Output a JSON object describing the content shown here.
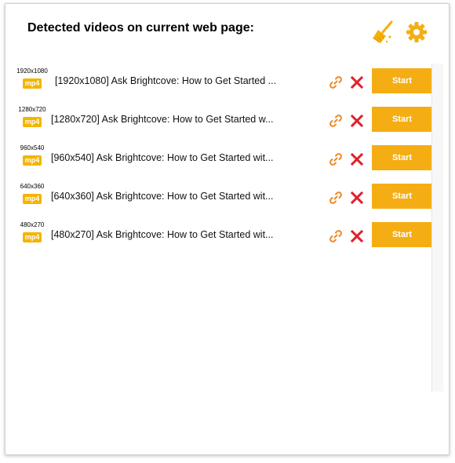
{
  "header": {
    "title": "Detected videos on current web page:"
  },
  "icons": {
    "clean": "broom-icon",
    "settings": "gear-icon"
  },
  "colors": {
    "accent": "#f4ae14",
    "badge": "#f4b400",
    "delete": "#e0202c",
    "link": "#f08a24"
  },
  "videos": [
    {
      "resolution": "1920x1080",
      "format": "mp4",
      "title": "[1920x1080] Ask Brightcove: How to Get Started ...",
      "action": "Start"
    },
    {
      "resolution": "1280x720",
      "format": "mp4",
      "title": "[1280x720] Ask Brightcove: How to Get Started w...",
      "action": "Start"
    },
    {
      "resolution": "960x540",
      "format": "mp4",
      "title": "[960x540] Ask Brightcove: How to Get Started wit...",
      "action": "Start"
    },
    {
      "resolution": "640x360",
      "format": "mp4",
      "title": "[640x360] Ask Brightcove: How to Get Started wit...",
      "action": "Start"
    },
    {
      "resolution": "480x270",
      "format": "mp4",
      "title": "[480x270] Ask Brightcove: How to Get Started wit...",
      "action": "Start"
    }
  ]
}
